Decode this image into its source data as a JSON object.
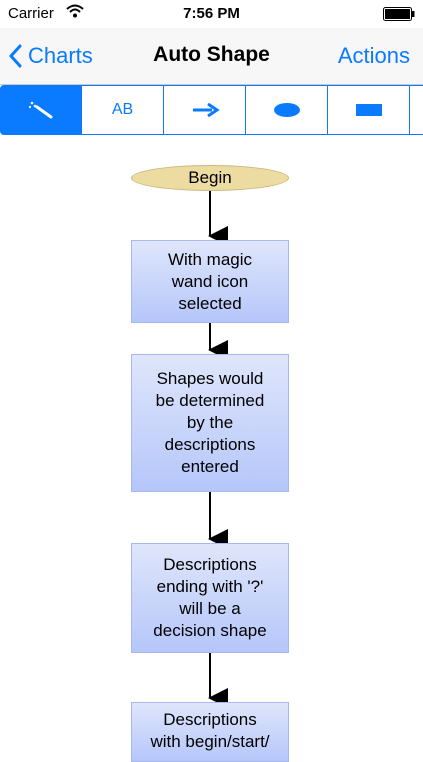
{
  "status_bar": {
    "carrier": "Carrier",
    "time": "7:56 PM"
  },
  "nav": {
    "back_label": "Charts",
    "title": "Auto Shape",
    "actions_label": "Actions"
  },
  "toolbar": {
    "tools": [
      {
        "name": "magic-wand",
        "icon": "magic-wand-icon",
        "selected": true
      },
      {
        "name": "text",
        "label": "AB"
      },
      {
        "name": "arrow",
        "icon": "arrow-right-icon"
      },
      {
        "name": "ellipse",
        "icon": "ellipse-icon"
      },
      {
        "name": "rectangle",
        "icon": "rectangle-icon"
      }
    ]
  },
  "flowchart": {
    "begin": "Begin",
    "step1": [
      "With magic",
      "wand icon",
      "selected"
    ],
    "step2": [
      "Shapes would",
      "be determined",
      "by the",
      "descriptions",
      "entered"
    ],
    "step3": [
      "Descriptions",
      "ending with '?'",
      "will be a",
      "decision shape"
    ],
    "step4": [
      "Descriptions",
      "with begin/start/"
    ]
  },
  "colors": {
    "accent": "#0a7aff",
    "box_fill_top": "#dfe6fb",
    "box_fill_bottom": "#b5c6fa",
    "terminal_fill": "#ecdca2"
  }
}
